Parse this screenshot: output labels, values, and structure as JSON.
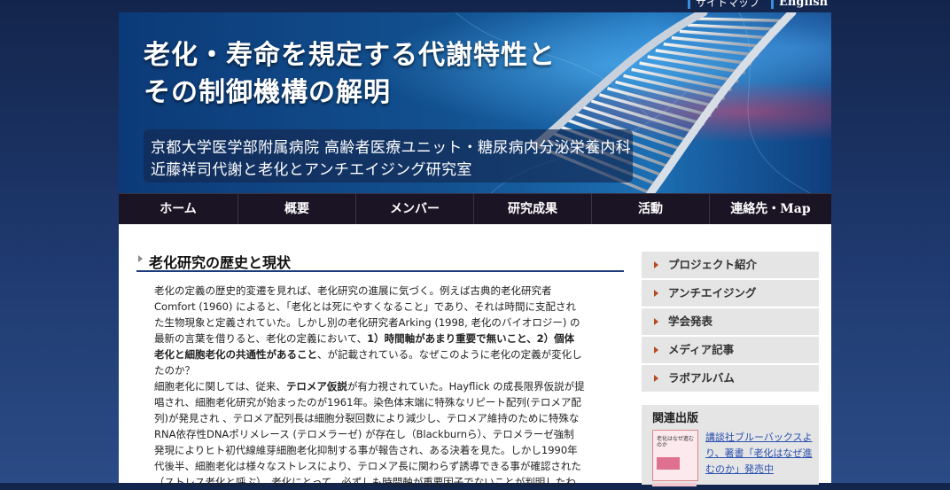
{
  "top_links": {
    "sitemap": "サイトマップ",
    "english": "English"
  },
  "banner": {
    "title_line1": "老化・寿命を規定する代謝特性と",
    "title_line2": "その制御機構の解明",
    "subtitle_line1": "京都大学医学部附属病院 高齢者医療ユニット・糖尿病内分泌栄養内科",
    "subtitle_line2": "近藤祥司代謝と老化とアンチエイジング研究室"
  },
  "nav": [
    {
      "label": "ホーム"
    },
    {
      "label": "概要"
    },
    {
      "label": "メンバー"
    },
    {
      "label": "研究成果"
    },
    {
      "label": "活動"
    },
    {
      "label": "連絡先・Map"
    }
  ],
  "article": {
    "heading": "老化研究の歴史と現状",
    "lines": [
      {
        "parts": [
          {
            "text": "老化の定義の歴史的変遷を見れば、老化研究の進展に気づく。例えば古典的老化研究者",
            "bold": false
          }
        ]
      },
      {
        "parts": [
          {
            "text": "Comfort (1960) によると、「老化とは死にやすくなること」であり、それは時間に支配され",
            "bold": false
          }
        ]
      },
      {
        "parts": [
          {
            "text": "た生物現象と定義されていた。しかし別の老化研究者Arking (1998, 老化のバイオロジー) の",
            "bold": false
          }
        ]
      },
      {
        "parts": [
          {
            "text": "最新の言葉を借りると、老化の定義において、",
            "bold": false
          },
          {
            "text": "1）時間軸があまり重要で無いこと、2）個体",
            "bold": true
          }
        ]
      },
      {
        "parts": [
          {
            "text": "老化と細胞老化の共通性があること",
            "bold": true
          },
          {
            "text": "、が記載されている。なぜこのように老化の定義が変化し",
            "bold": false
          }
        ]
      },
      {
        "parts": [
          {
            "text": "たのか？",
            "bold": false
          }
        ]
      },
      {
        "parts": [
          {
            "text": "細胞老化に関しては、従来、",
            "bold": false
          },
          {
            "text": "テロメア仮説",
            "bold": true
          },
          {
            "text": "が有力視されていた。Hayflick の成長限界仮説が提",
            "bold": false
          }
        ]
      },
      {
        "parts": [
          {
            "text": "唱され、細胞老化研究が始まったのが1961年。染色体末端に特殊なリピート配列(テロメア配",
            "bold": false
          }
        ]
      },
      {
        "parts": [
          {
            "text": "列)が発見され 、テロメア配列長は細胞分裂回数により減少し、テロメア維持のために特殊な",
            "bold": false
          }
        ]
      },
      {
        "parts": [
          {
            "text": "RNA依存性DNAポリメレース (テロメラーゼ) が存在し（Blackburnら）、テロメラーゼ強制",
            "bold": false
          }
        ]
      },
      {
        "parts": [
          {
            "text": "発現によりヒト初代線維芽細胞老化抑制する事が報告され、ある決着を見た。しかし1990年",
            "bold": false
          }
        ]
      },
      {
        "parts": [
          {
            "text": "代後半、細胞老化は様々なストレスにより、テロメア長に関わらず誘導できる事が確認された",
            "bold": false
          }
        ]
      },
      {
        "parts": [
          {
            "text": "（ストレス老化と呼ぶ）。老化にとって、必ずしも時間軸が重要因子でないことが判明したわ",
            "bold": false
          }
        ]
      }
    ]
  },
  "sidebar": {
    "items": [
      {
        "label": "プロジェクト紹介"
      },
      {
        "label": "アンチエイジング"
      },
      {
        "label": "学会発表"
      },
      {
        "label": "メディア記事"
      },
      {
        "label": "ラボアルバム"
      }
    ],
    "publication": {
      "heading": "関連出版",
      "book_cover_text": "老化はなぜ進むのか",
      "link_text": "講談社ブルーバックスより、著書「老化はなぜ進むのか」発売中"
    }
  }
}
